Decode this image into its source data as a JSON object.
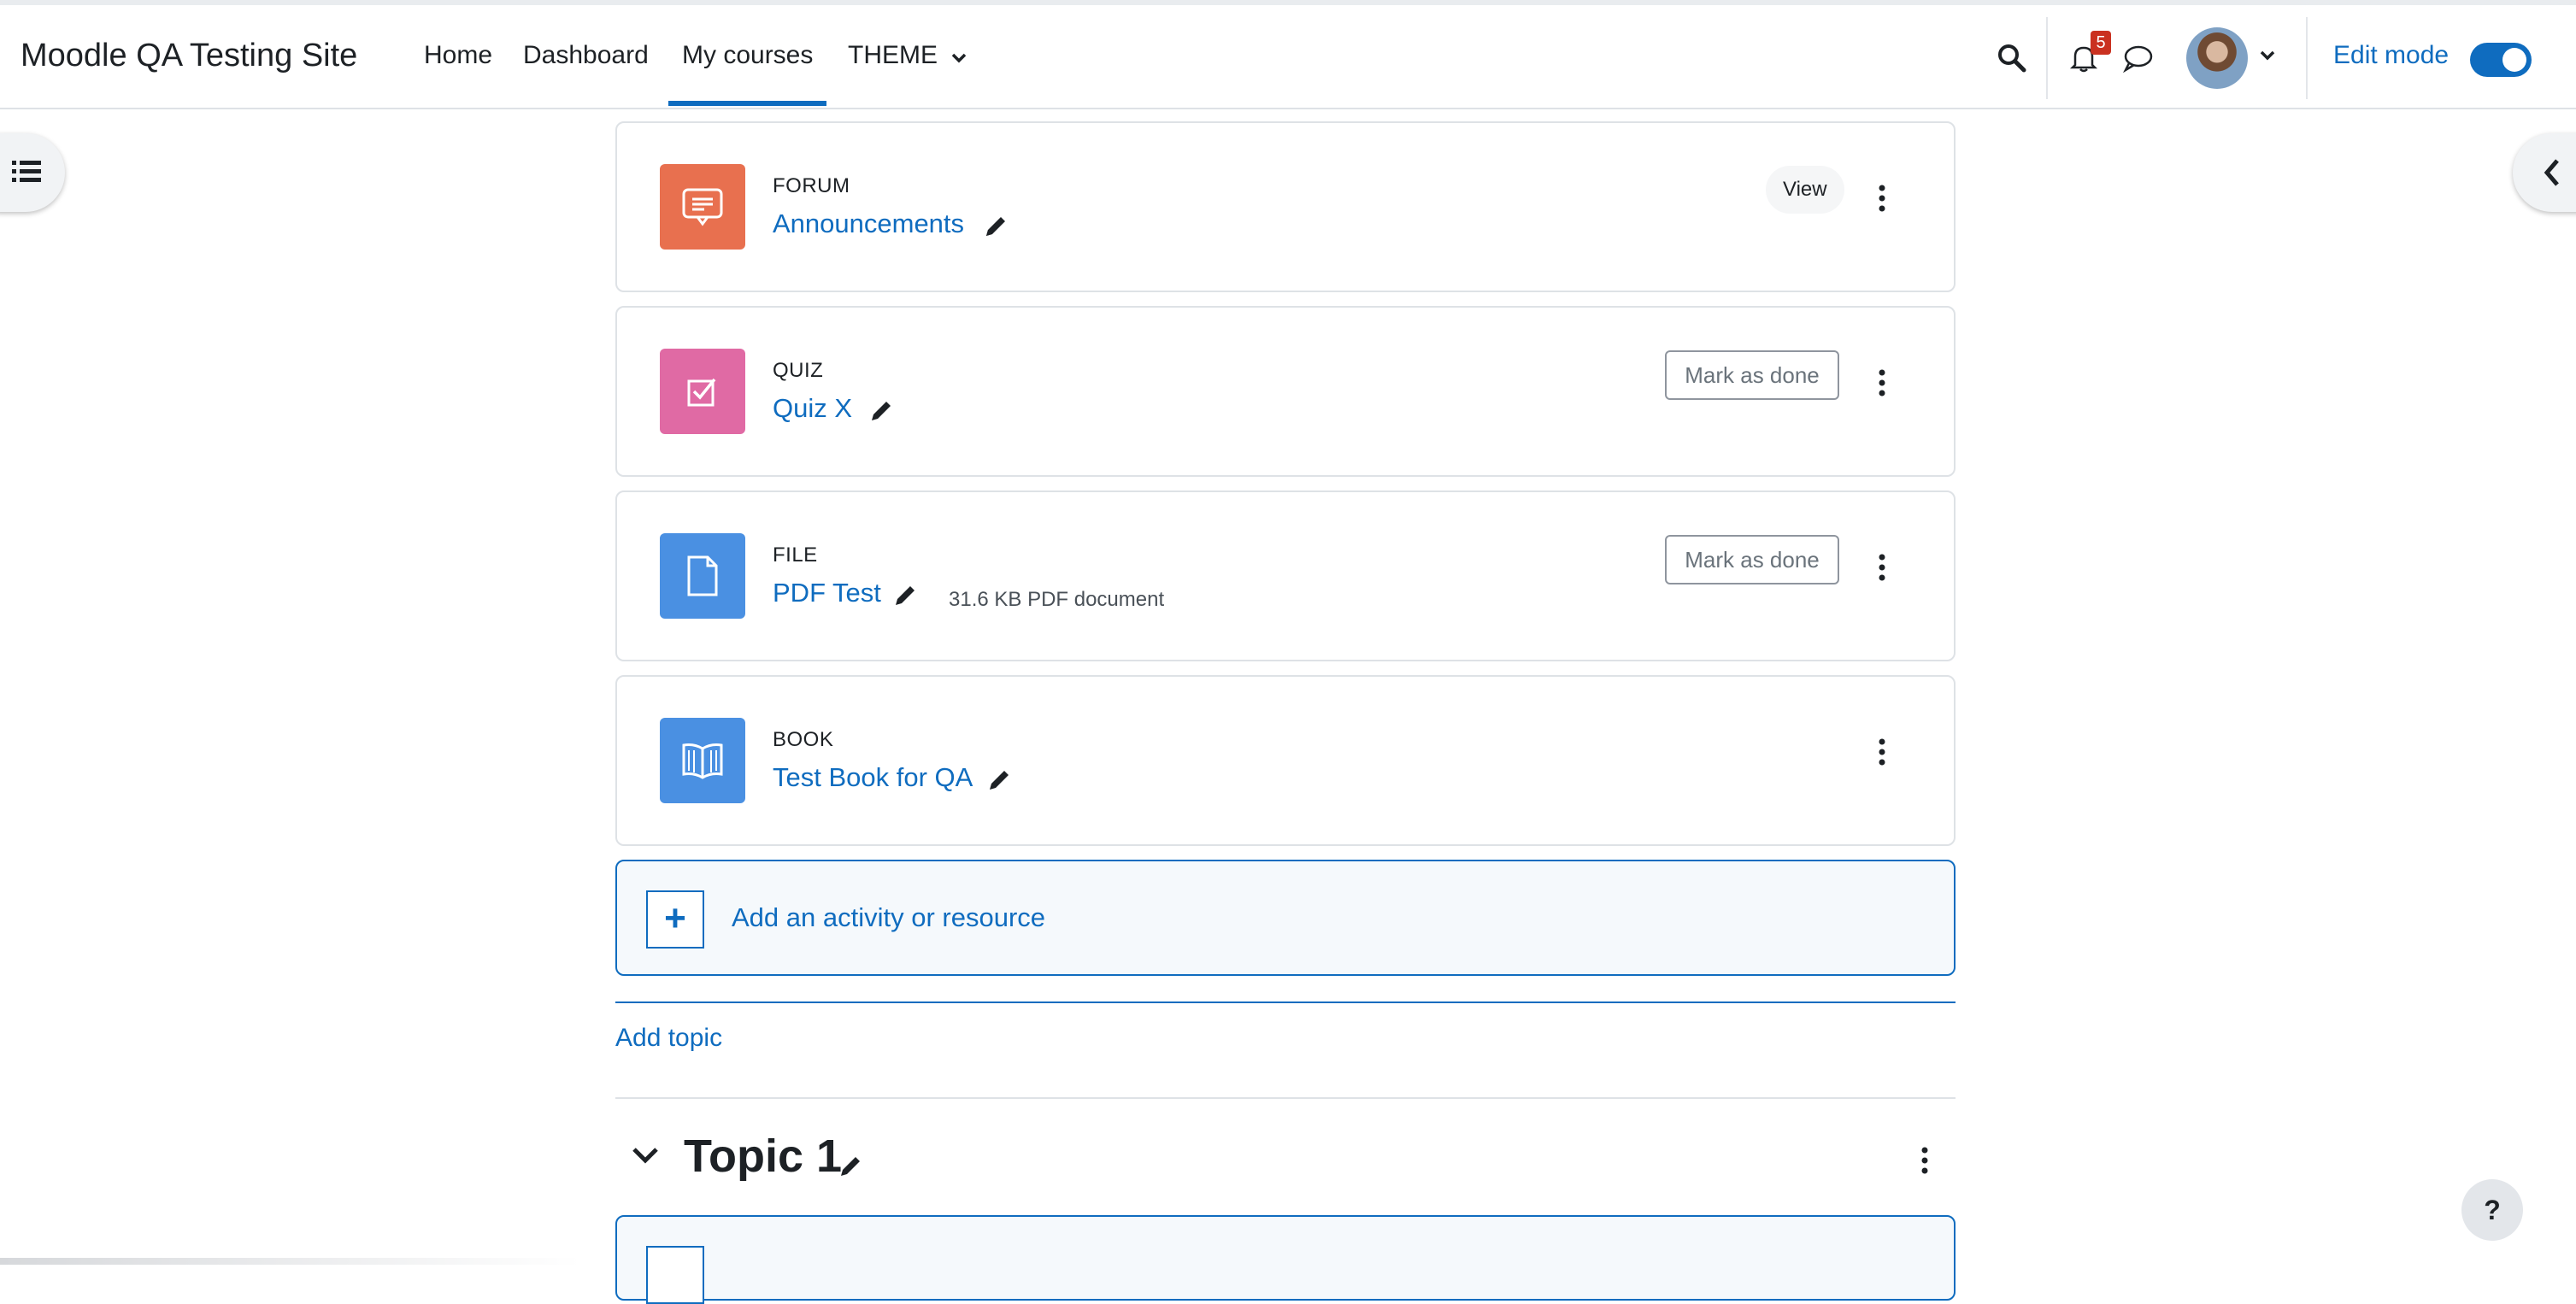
{
  "header": {
    "site_name": "Moodle QA Testing Site",
    "nav": [
      {
        "label": "Home"
      },
      {
        "label": "Dashboard"
      },
      {
        "label": "My courses",
        "active": true
      },
      {
        "label": "THEME"
      }
    ],
    "notification_count": "5",
    "edit_mode_label": "Edit mode",
    "edit_mode_on": true
  },
  "activities": [
    {
      "type": "FORUM",
      "name": "Announcements",
      "action": "View",
      "icon": "forum-icon",
      "color": "#e8704f"
    },
    {
      "type": "QUIZ",
      "name": "Quiz X",
      "action": "Mark as done",
      "icon": "quiz-icon",
      "color": "#e06aa4"
    },
    {
      "type": "FILE",
      "name": "PDF Test",
      "extra": "31.6 KB PDF document",
      "action": "Mark as done",
      "icon": "file-icon",
      "color": "#4a90e2"
    },
    {
      "type": "BOOK",
      "name": "Test Book for QA",
      "icon": "book-icon",
      "color": "#4a90e2"
    }
  ],
  "add_activity_label": "Add an activity or resource",
  "add_topic_label": "Add topic",
  "section": {
    "title": "Topic 1"
  },
  "help_label": "?",
  "colors": {
    "primary": "#0f6cbf",
    "badge": "#ca3120"
  }
}
